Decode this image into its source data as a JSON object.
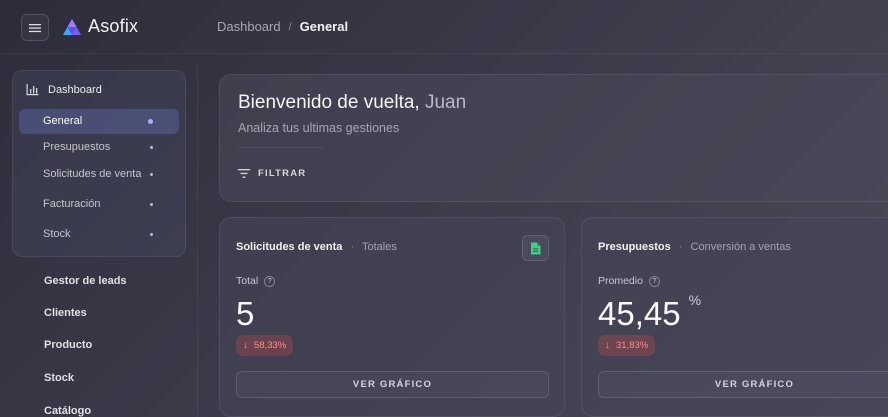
{
  "app": {
    "name": "Asofix"
  },
  "breadcrumb": {
    "items": [
      "Dashboard",
      "General"
    ],
    "separator": "/"
  },
  "sidebar": {
    "group_title": "Dashboard",
    "sub_items": [
      {
        "label": "General",
        "active": true
      },
      {
        "label": "Presupuestos",
        "active": false
      },
      {
        "label": "Solicitudes de venta",
        "active": false
      },
      {
        "label": "Facturación",
        "active": false
      },
      {
        "label": "Stock",
        "active": false
      }
    ],
    "main_items": [
      "Gestor de leads",
      "Clientes",
      "Producto",
      "Stock",
      "Catálogo"
    ]
  },
  "hero": {
    "greeting": "Bienvenido de vuelta,",
    "name": "Juan",
    "subtitle": "Analiza tus ultimas gestiones",
    "filter_label": "FILTRAR"
  },
  "cards": [
    {
      "title": "Solicitudes de venta",
      "separator": "·",
      "description": "Totales",
      "metric_label": "Total",
      "help_symbol": "?",
      "value": "5",
      "unit": "",
      "change": "58,33%",
      "change_direction": "down",
      "button_label": "VER GRÁFICO",
      "icon": "document-icon"
    },
    {
      "title": "Presupuestos",
      "separator": "·",
      "description": "Conversión a ventas",
      "metric_label": "Promedio",
      "help_symbol": "?",
      "value": "45,45",
      "unit": "%",
      "change": "31,83%",
      "change_direction": "down",
      "button_label": "VER GRÁFICO"
    }
  ],
  "colors": {
    "accent": "#a9b0ff",
    "negative": "#ff8a8a",
    "icon_green": "#3ecf8e"
  }
}
